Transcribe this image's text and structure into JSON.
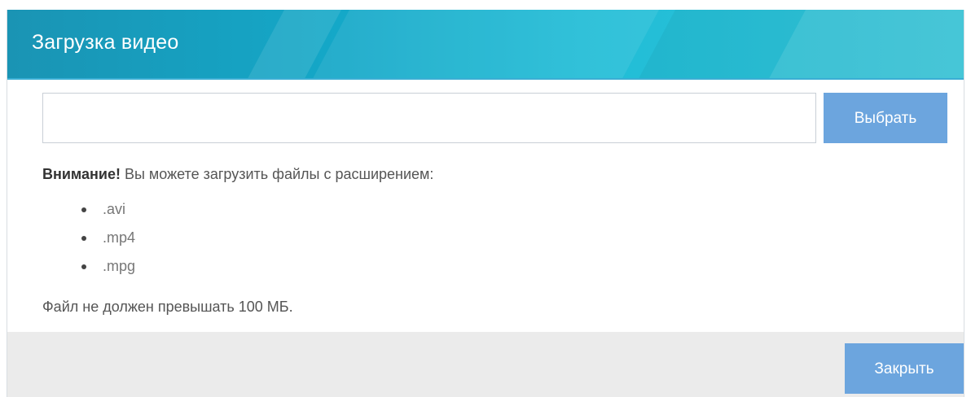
{
  "dialog": {
    "title": "Загрузка видео"
  },
  "upload": {
    "file_value": "",
    "file_placeholder": "",
    "browse_label": "Выбрать"
  },
  "info": {
    "warning_bold": "Внимание!",
    "warning_text": " Вы можете загрузить файлы с расширением:",
    "extensions": [
      ".avi",
      ".mp4",
      ".mpg"
    ],
    "size_limit": "Файл не должен превышать 100 МБ."
  },
  "footer": {
    "close_label": "Закрыть"
  },
  "colors": {
    "header": "#14a8c8",
    "button": "#6ca5de",
    "footer_bg": "#ebebeb"
  }
}
